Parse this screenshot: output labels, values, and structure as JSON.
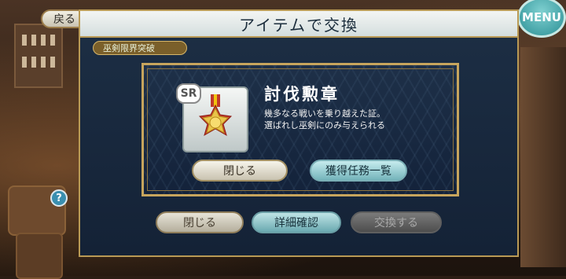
{
  "header": {
    "back_label": "戻る",
    "menu_label": "MENU",
    "help_label": "?"
  },
  "dialog": {
    "title": "アイテムで交換",
    "tab_label": "巫剣限界突破",
    "buttons": {
      "close": "閉じる",
      "details": "詳細確認",
      "exchange": "交換する"
    }
  },
  "item_popup": {
    "rarity": "SR",
    "name": "討伐勲章",
    "description_line1": "幾多なる戦いを乗り越えた証。",
    "description_line2": "選ばれし巫剣にのみ与えられる",
    "buttons": {
      "close": "閉じる",
      "quest_list": "獲得任務一覧"
    }
  },
  "colors": {
    "accent_teal": "#74b4bb",
    "gold_frame": "#c7a55d",
    "panel_navy": "#1e3048"
  }
}
